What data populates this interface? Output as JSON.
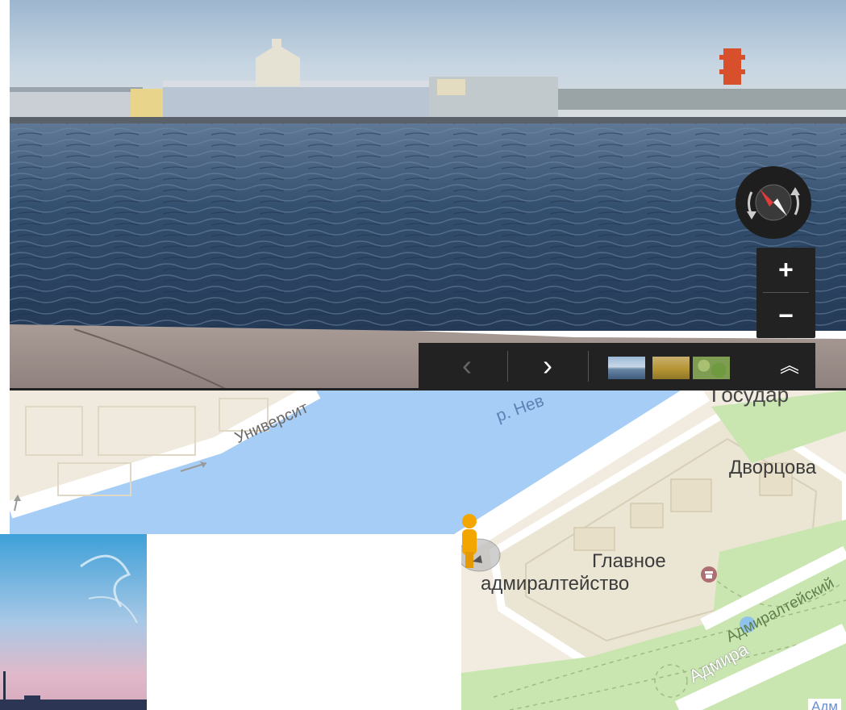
{
  "streetview": {
    "controls": {
      "compass_icon": "compass-icon",
      "zoom_in_label": "+",
      "zoom_out_label": "−"
    },
    "filmstrip": {
      "prev_label": "‹",
      "next_label": "›",
      "expand_label": "︽",
      "thumbnails": [
        "photo-water",
        "photo-gold",
        "photo-green"
      ]
    }
  },
  "map": {
    "labels": {
      "river": "р. Нев",
      "street_universitetskaya": "Университ",
      "gosudar": "Государ",
      "dvortsovaya": "Дворцова",
      "admiralty_line1": "Главное",
      "admiralty_line2": "адмиралтейство",
      "admiralty_garden": "Адмиралтейский",
      "admiralty_street": "Адмира",
      "bottom_right": "Адм"
    },
    "colors": {
      "water": "#a6cdf5",
      "land": "#f1ecdf",
      "park": "#c9e6b1",
      "road": "#ffffff"
    }
  }
}
